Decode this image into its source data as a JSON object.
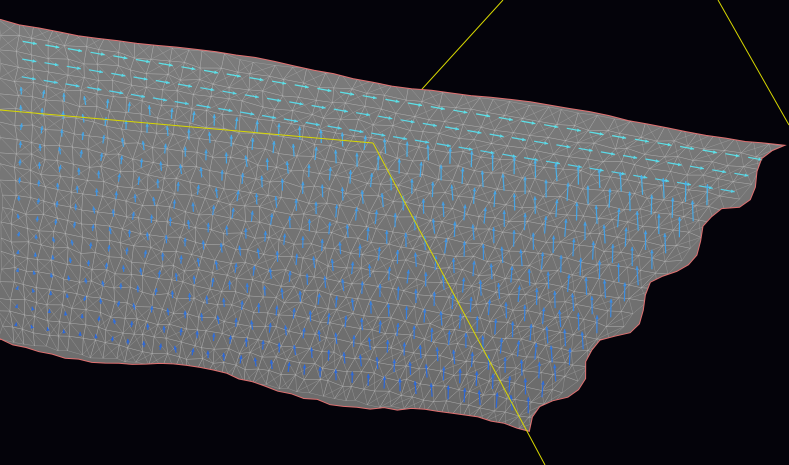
{
  "scene": {
    "description_visible_text": "",
    "colors": {
      "background": "#04030a",
      "surface_fill": "#7d7d7d",
      "surface_fill_dark": "#6a6a6a",
      "mesh_lines": "#c8c8c8",
      "outline": "#e07070",
      "axis_lines": "#d8d800",
      "vector_cyan": "#5fe8e8",
      "vector_light_blue": "#4ab0e8",
      "vector_blue": "#2a62d8"
    },
    "glyph_name": "arrow-vector-glyph",
    "render_mode": "wireframe-over-shaded-surface"
  }
}
